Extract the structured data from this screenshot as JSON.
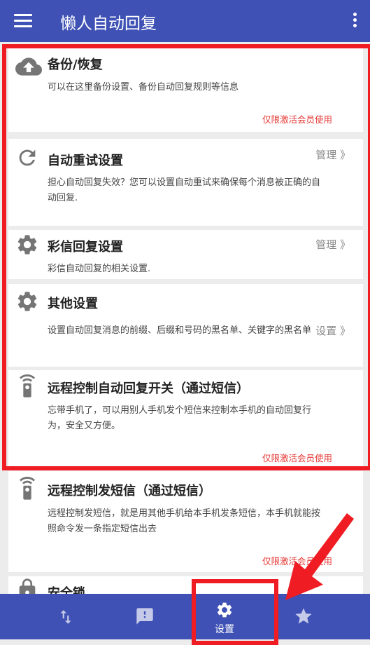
{
  "app": {
    "title": "懒人自动回复"
  },
  "cards": [
    {
      "title": "备份/恢复",
      "desc": "可以在这里备份设置、备份自动回复规则等信息",
      "member": "仅限激活会员使用",
      "icon": "cloud-upload-icon"
    },
    {
      "title": "自动重试设置",
      "desc": "担心自动回复失效？您可以设置自动重试来确保每个消息被正确的自动回复.",
      "action": "管理 》",
      "icon": "refresh-icon"
    },
    {
      "title": "彩信回复设置",
      "desc": "彩信自动回复的相关设置.",
      "action": "管理 》",
      "icon": "gear-icon"
    },
    {
      "title": "其他设置",
      "desc": "设置自动回复消息的前缀、后缀和号码的黑名单、关键字的黑名单",
      "action": "设置 》",
      "icon": "gear-icon"
    },
    {
      "title": "远程控制自动回复开关（通过短信）",
      "desc": "忘带手机了，可以用别人手机发个短信来控制本手机的自动回复行为，安全又方便。",
      "member": "仅限激活会员使用",
      "icon": "remote-icon"
    },
    {
      "title": "远程控制发短信（通过短信）",
      "desc": "远程控制发短信，就是用其他手机给本手机发条短信，本手机就能按照命令发一条指定短信出去",
      "member": "仅限激活会员使用",
      "icon": "remote-icon"
    },
    {
      "title": "安全锁",
      "icon": "lock-icon"
    }
  ],
  "bottom_nav": {
    "items": [
      {
        "icon": "swap-icon"
      },
      {
        "icon": "feedback-icon"
      },
      {
        "icon": "gear-icon",
        "label": "设置"
      },
      {
        "icon": "star-icon"
      }
    ]
  },
  "colors": {
    "primary": "#3f51b5",
    "highlight": "#f01c23",
    "member_text": "#e53935"
  }
}
